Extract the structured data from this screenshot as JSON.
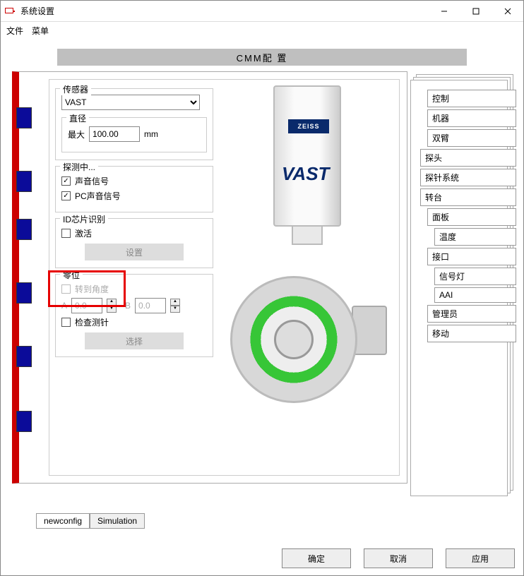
{
  "window": {
    "title": "系统设置"
  },
  "menu": {
    "file": "文件",
    "menu": "菜单"
  },
  "page_title": "CMM配 置",
  "sensor": {
    "group_label": "传感器",
    "selected": "VAST",
    "diameter_group": "直径",
    "max_label": "最大",
    "max_value": "100.00",
    "unit": "mm"
  },
  "probing": {
    "group_label": "探测中...",
    "sound": "声音信号",
    "sound_checked": true,
    "pc_sound": "PC声音信号",
    "pc_sound_checked": true
  },
  "chip_id": {
    "group_label": "ID芯片识别",
    "activate": "激活",
    "activate_checked": false,
    "settings_btn": "设置"
  },
  "zero": {
    "group_label": "零位",
    "rotate_to_angle": "转到角度",
    "rotate_checked": false,
    "a_label": "A",
    "a_value": "0.0",
    "b_label": "B",
    "b_value": "0.0",
    "check_stylus": "检查测针",
    "check_checked": false,
    "select_btn": "选择"
  },
  "image_labels": {
    "brand": "ZEISS",
    "model": "VAST"
  },
  "nav": {
    "items": [
      {
        "label": "控制",
        "indent": 1
      },
      {
        "label": "机器",
        "indent": 1
      },
      {
        "label": "双臂",
        "indent": 1
      },
      {
        "label": "探头",
        "indent": 0
      },
      {
        "label": "探针系统",
        "indent": 0
      },
      {
        "label": "转台",
        "indent": 0
      },
      {
        "label": "面板",
        "indent": 1
      },
      {
        "label": "温度",
        "indent": 2
      },
      {
        "label": "接口",
        "indent": 1
      },
      {
        "label": "信号灯",
        "indent": 2
      },
      {
        "label": "AAI",
        "indent": 2
      },
      {
        "label": "管理员",
        "indent": 1
      },
      {
        "label": "移动",
        "indent": 1
      }
    ]
  },
  "bottom_tabs": {
    "newconfig": "newconfig",
    "simulation": "Simulation"
  },
  "footer": {
    "ok": "确定",
    "cancel": "取消",
    "apply": "应用"
  }
}
